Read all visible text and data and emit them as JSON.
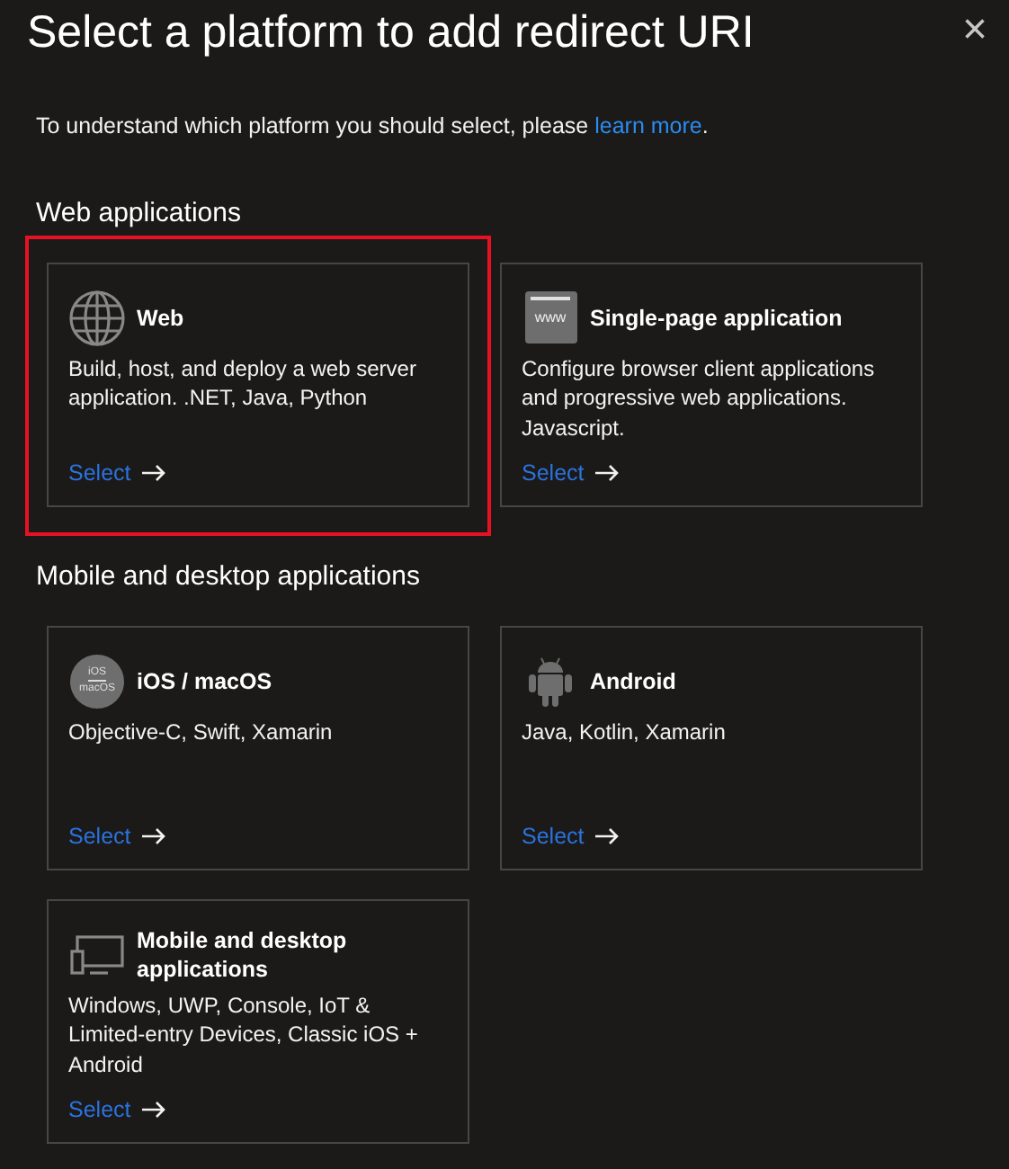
{
  "panel": {
    "title": "Select a platform to add redirect URI",
    "close": "×"
  },
  "intro": {
    "text": "To understand which platform you should select, please ",
    "link": "learn more",
    "after": "."
  },
  "sections": [
    {
      "heading": "Web applications",
      "cards": [
        {
          "kind": "globe",
          "title": "Web",
          "description": "Build, host, and deploy a web server application. .NET, Java, Python",
          "action": "Select",
          "highlighted": true
        },
        {
          "kind": "www",
          "icon_text": [
            "www"
          ],
          "title": "Single-page application",
          "description": "Configure browser client applications and progressive web applications. Javascript.",
          "action": "Select",
          "highlighted": false
        }
      ]
    },
    {
      "heading": "Mobile and desktop applications",
      "cards": [
        {
          "kind": "apple",
          "icon_text": [
            "iOS",
            "macOS"
          ],
          "title": "iOS / macOS",
          "description": "Objective-C, Swift, Xamarin",
          "action": "Select",
          "highlighted": false
        },
        {
          "kind": "android",
          "title": "Android",
          "description": "Java, Kotlin, Xamarin",
          "action": "Select",
          "highlighted": false
        },
        {
          "kind": "devices",
          "title": "Mobile and desktop applications",
          "description": "Windows, UWP, Console, IoT & Limited-entry Devices, Classic iOS + Android",
          "action": "Select",
          "highlighted": false
        }
      ]
    }
  ]
}
